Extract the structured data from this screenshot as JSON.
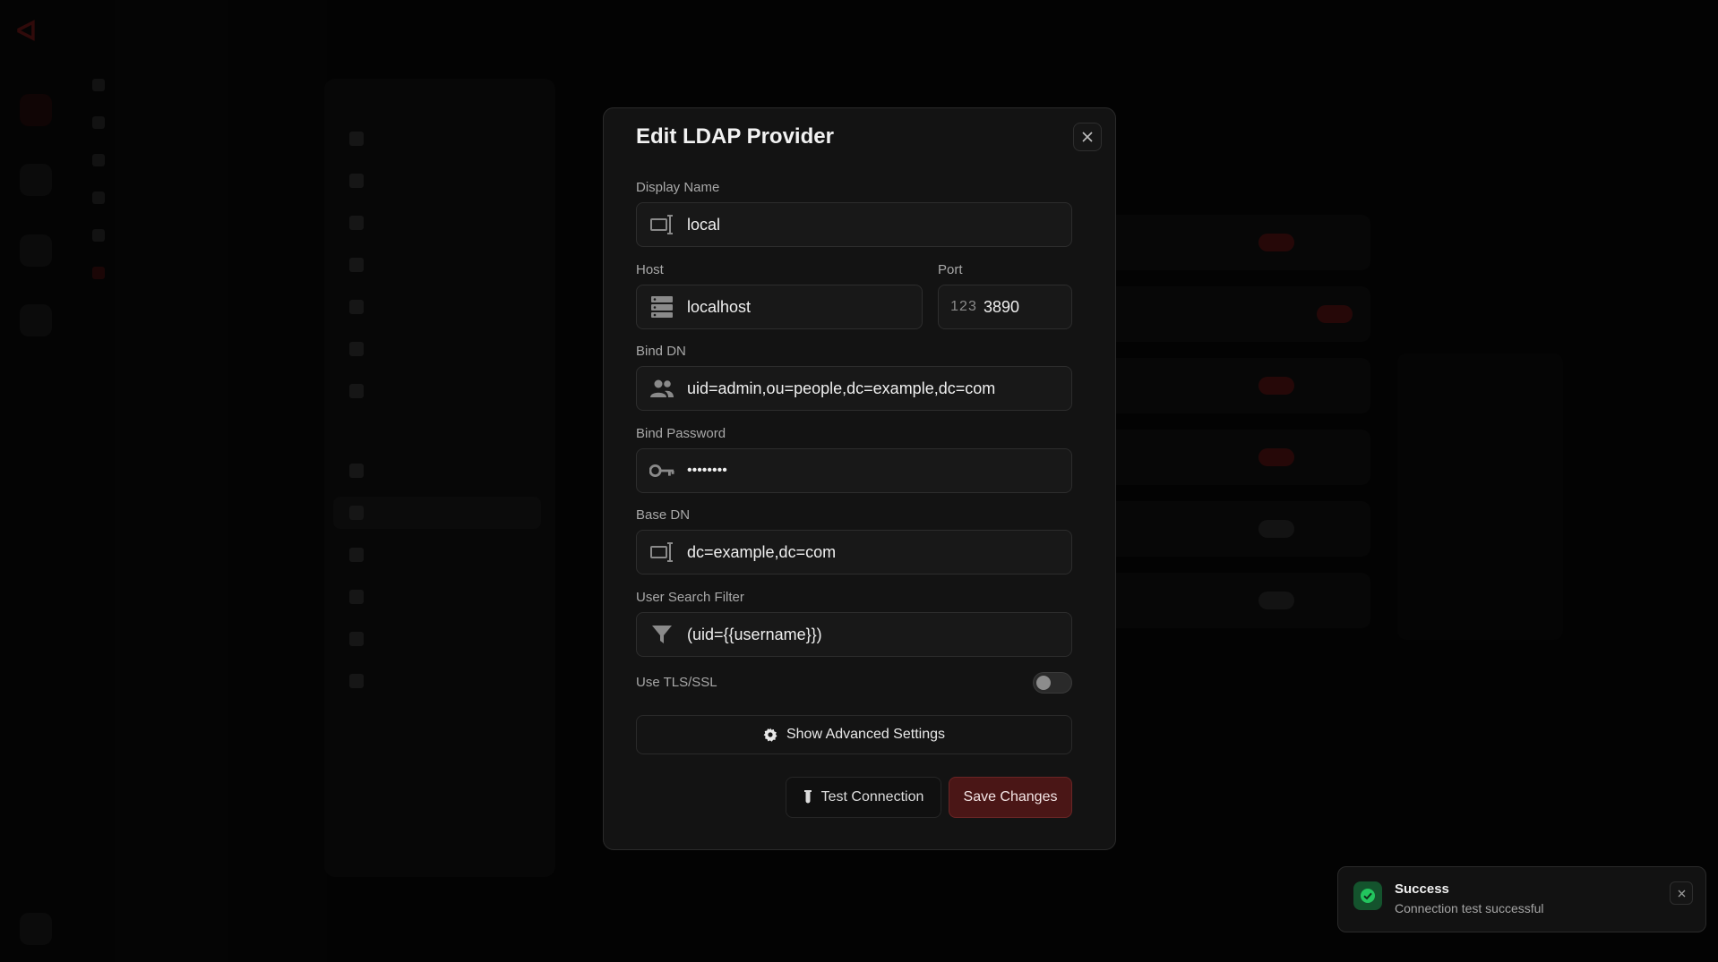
{
  "modal": {
    "title": "Edit LDAP Provider",
    "close_icon": "close-icon",
    "fields": {
      "display_name": {
        "label": "Display Name",
        "value": "local",
        "icon": "display-name-icon"
      },
      "host": {
        "label": "Host",
        "value": "localhost",
        "icon": "server-icon"
      },
      "port": {
        "label": "Port",
        "value": "3890",
        "icon": "numeric-123-icon",
        "icon_text": "123"
      },
      "bind_dn": {
        "label": "Bind DN",
        "value": "uid=admin,ou=people,dc=example,dc=com",
        "icon": "users-icon"
      },
      "bind_password": {
        "label": "Bind Password",
        "value": "••••••••",
        "icon": "key-icon"
      },
      "base_dn": {
        "label": "Base DN",
        "value": "dc=example,dc=com",
        "icon": "base-dn-icon"
      },
      "user_search_filter": {
        "label": "User Search Filter",
        "value": "(uid={{username}})",
        "icon": "filter-icon"
      }
    },
    "tls": {
      "label": "Use TLS/SSL",
      "enabled": false
    },
    "advanced_button": {
      "label": "Show Advanced Settings",
      "icon": "gear-icon"
    },
    "test_button": {
      "label": "Test Connection",
      "icon": "test-tube-icon"
    },
    "save_button": {
      "label": "Save Changes"
    }
  },
  "toast": {
    "title": "Success",
    "message": "Connection test successful",
    "icon": "check-circle-icon",
    "status_color": "#22c55e"
  },
  "colors": {
    "accent": "#4a1616",
    "modal_bg": "#131313",
    "page_bg": "#050505"
  }
}
